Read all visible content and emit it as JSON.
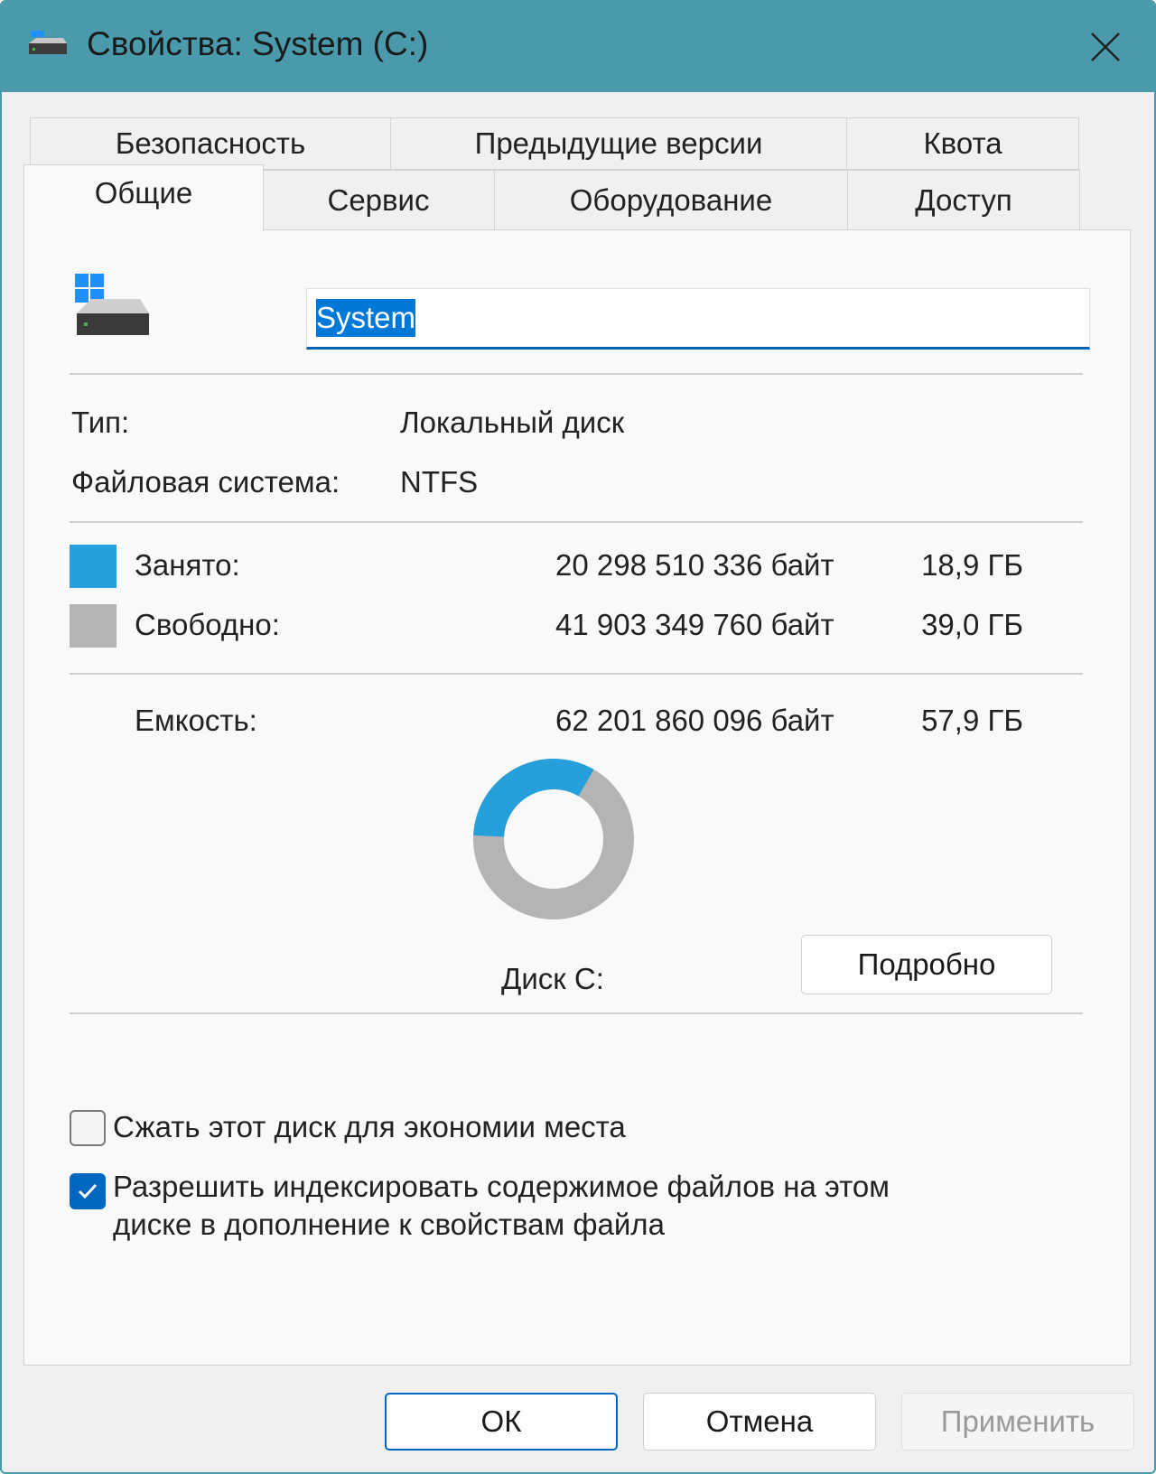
{
  "window": {
    "title": "Свойства: System (C:)",
    "accent_color": "#4a9aab"
  },
  "tabs": {
    "row1": [
      "Безопасность",
      "Предыдущие версии",
      "Квота"
    ],
    "row2": [
      "Общие",
      "Сервис",
      "Оборудование",
      "Доступ"
    ],
    "active": "Общие"
  },
  "general": {
    "volume_name": "System",
    "type_label": "Тип:",
    "type_value": "Локальный диск",
    "fs_label": "Файловая система:",
    "fs_value": "NTFS",
    "used": {
      "label": "Занято:",
      "bytes": "20 298 510 336 байт",
      "size": "18,9 ГБ",
      "color": "#26a0da",
      "fraction": 0.326
    },
    "free": {
      "label": "Свободно:",
      "bytes": "41 903 349 760 байт",
      "size": "39,0 ГБ",
      "color": "#b4b4b4"
    },
    "capacity": {
      "label": "Емкость:",
      "bytes": "62 201 860 096 байт",
      "size": "57,9 ГБ"
    },
    "disk_label": "Диск C:",
    "details_button": "Подробно",
    "compress_label": "Сжать этот диск для экономии места",
    "compress_checked": false,
    "index_label_line1": "Разрешить индексировать содержимое файлов на этом",
    "index_label_line2": "диске в дополнение к свойствам файла",
    "index_checked": true
  },
  "buttons": {
    "ok": "ОК",
    "cancel": "Отмена",
    "apply": "Применить"
  },
  "icons": [
    "drive-icon",
    "close-icon",
    "checkmark-icon"
  ]
}
